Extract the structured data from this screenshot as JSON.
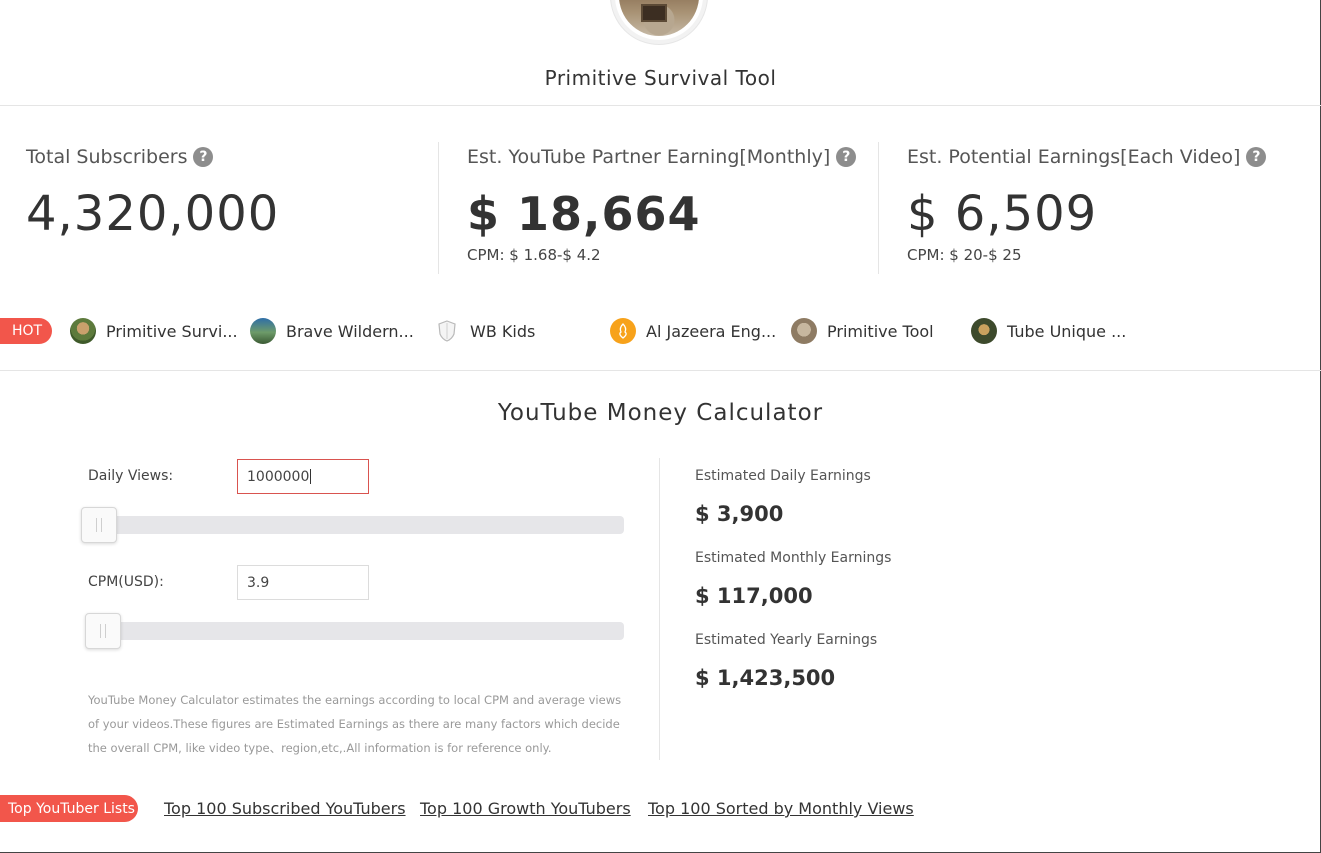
{
  "channel": {
    "name": "Primitive Survival Tool"
  },
  "stats": [
    {
      "label": "Total Subscribers",
      "value": "4,320,000",
      "sub": ""
    },
    {
      "label": "Est. YouTube Partner Earning[Monthly]",
      "value": "$ 18,664",
      "sub": "CPM: $ 1.68-$ 4.2"
    },
    {
      "label": "Est. Potential Earnings[Each Video]",
      "value": "$ 6,509",
      "sub": "CPM: $ 20-$ 25"
    }
  ],
  "hot": {
    "badge": "HOT",
    "items": [
      {
        "label": "Primitive Survi..."
      },
      {
        "label": "Brave Wildern..."
      },
      {
        "label": "WB Kids"
      },
      {
        "label": "Al Jazeera Eng..."
      },
      {
        "label": "Primitive Tool"
      },
      {
        "label": "Tube Unique ..."
      }
    ]
  },
  "calculator": {
    "title": "YouTube Money Calculator",
    "daily_views_label": "Daily Views:",
    "daily_views_value": "1000000",
    "cpm_label": "CPM(USD):",
    "cpm_value": "3.9",
    "note": "YouTube Money Calculator estimates the earnings according to local CPM and average views of your videos.These figures are Estimated Earnings as there are many factors which decide the overall CPM, like video type、region,etc,.All information is for reference only.",
    "results": [
      {
        "label": "Estimated Daily Earnings",
        "value": "$ 3,900"
      },
      {
        "label": "Estimated Monthly Earnings",
        "value": "$ 117,000"
      },
      {
        "label": "Estimated Yearly Earnings",
        "value": "$ 1,423,500"
      }
    ]
  },
  "top_lists": {
    "badge": "Top YouTuber Lists",
    "links": [
      {
        "label": "Top 100 Subscribed YouTubers"
      },
      {
        "label": "Top 100 Growth YouTubers"
      },
      {
        "label": "Top 100 Sorted by Monthly Views"
      }
    ]
  },
  "icons": {
    "help": "question-icon",
    "accent_color": "#f2564b",
    "active_input_border": "#d9534f"
  }
}
